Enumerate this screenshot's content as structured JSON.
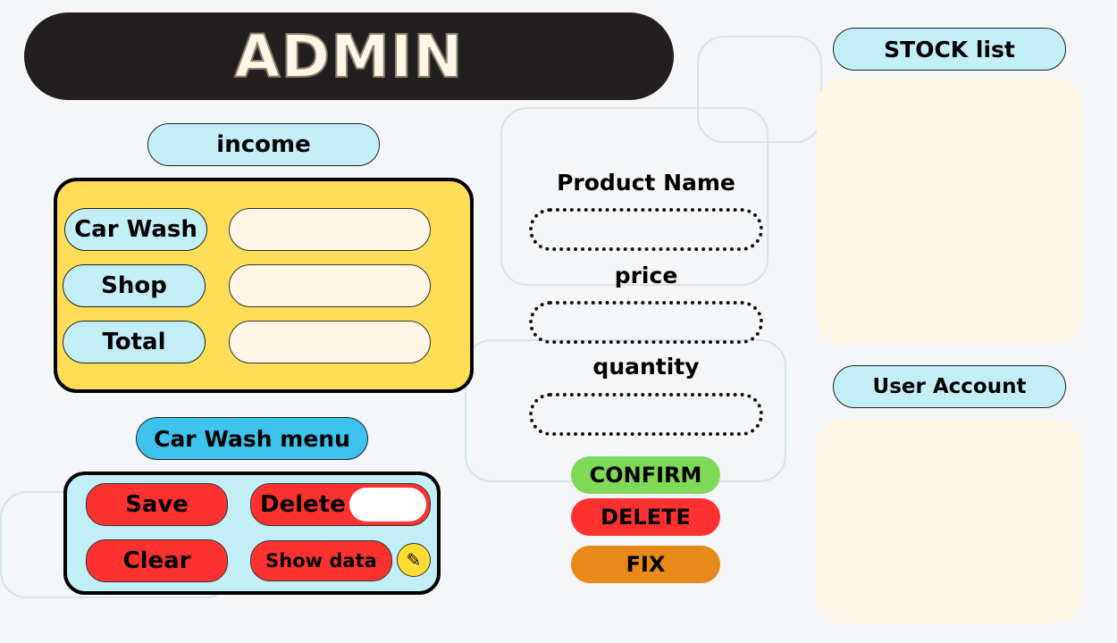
{
  "header": {
    "title": "ADMIN"
  },
  "income": {
    "title": "income",
    "rows": [
      {
        "label": "Car Wash",
        "value": ""
      },
      {
        "label": "Shop",
        "value": ""
      },
      {
        "label": "Total",
        "value": ""
      }
    ]
  },
  "menu": {
    "title": "Car Wash menu",
    "save": "Save",
    "delete": "Delete",
    "clear": "Clear",
    "show_data": "Show data"
  },
  "product": {
    "name_label": "Product Name",
    "price_label": "price",
    "quantity_label": "quantity",
    "name_value": "",
    "price_value": "",
    "quantity_value": ""
  },
  "actions": {
    "confirm": "CONFIRM",
    "delete": "DELETE",
    "fix": "FIX"
  },
  "right": {
    "stock_title": "STOCK list",
    "user_title": "User Account"
  },
  "colors": {
    "yellow": "#ffdd57",
    "cyan": "#c2eff6",
    "blue": "#3ec3ee",
    "red": "#fe3131",
    "green": "#7ed957",
    "orange": "#e8891a",
    "cream": "#fff6e6"
  }
}
